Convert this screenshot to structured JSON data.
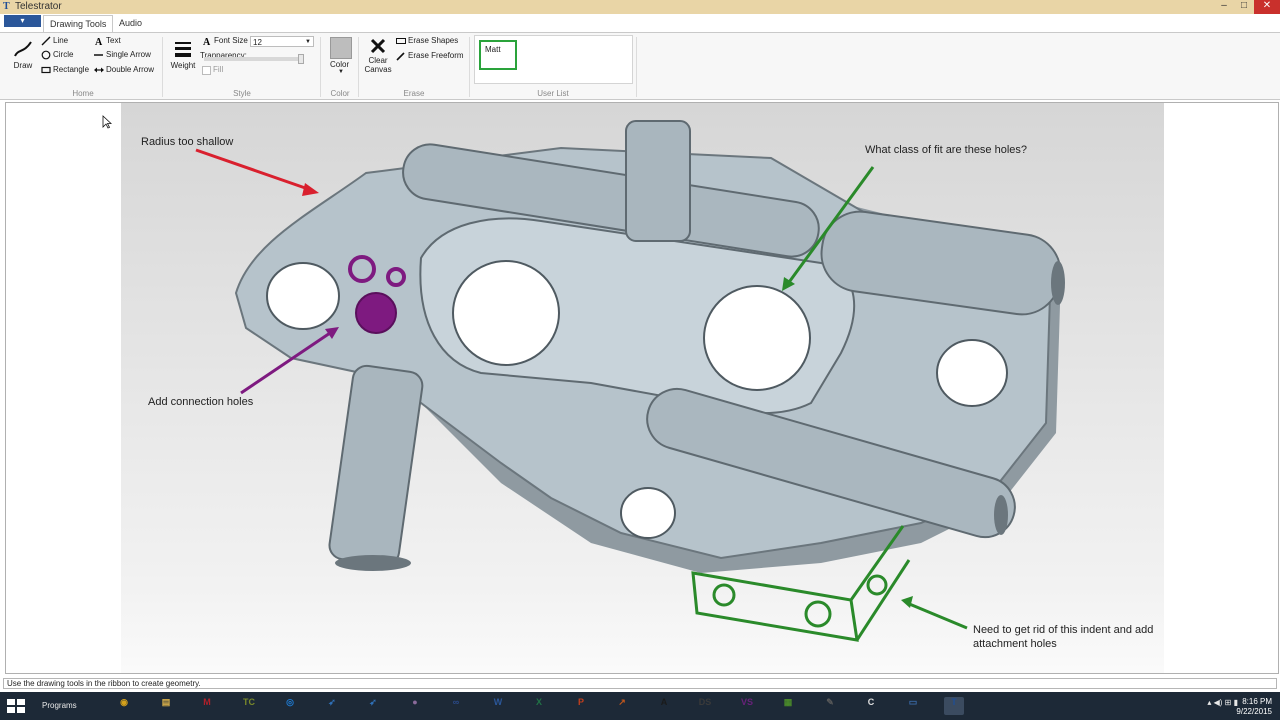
{
  "window": {
    "title": "Telestrator",
    "app_icon_letter": "T",
    "minimize": "–",
    "maximize": "□",
    "close": "✕"
  },
  "tabs": {
    "file_arrow": "▾",
    "drawing_tools": "Drawing Tools",
    "audio": "Audio"
  },
  "ribbon": {
    "home": {
      "draw": "Draw",
      "line": "Line",
      "circle": "Circle",
      "rectangle": "Rectangle",
      "text": "Text",
      "single_arrow": "Single Arrow",
      "double_arrow": "Double Arrow",
      "group_label": "Home"
    },
    "style": {
      "weight": "Weight",
      "font_size_label": "Font Size",
      "font_size_value": "12",
      "transparency": "Tranparency:",
      "fill": "Fill",
      "group_label": "Style"
    },
    "color": {
      "color": "Color",
      "group_label": "Color"
    },
    "erase": {
      "clear_canvas_line1": "Clear",
      "clear_canvas_line2": "Canvas",
      "erase_shapes": "Erase Shapes",
      "erase_freeform": "Erase Freeform",
      "group_label": "Erase"
    },
    "user_list": {
      "user": "Matt",
      "group_label": "User List"
    }
  },
  "annotations": {
    "radius": "Radius too shallow",
    "fit": "What class of fit are these holes?",
    "connection": "Add connection holes",
    "indent_line1": "Need to get rid of this indent and add",
    "indent_line2": "attachment holes"
  },
  "colors": {
    "red": "#d9202e",
    "green": "#2a8a2a",
    "purple": "#7e1a80"
  },
  "status": "Use the drawing tools in the ribbon to create geometry.",
  "taskbar": {
    "programs": "Programs",
    "apps": [
      {
        "name": "chrome",
        "glyph": "◉",
        "color": "#d6a21b"
      },
      {
        "name": "file-explorer",
        "glyph": "▤",
        "color": "#d9b04a"
      },
      {
        "name": "app-red",
        "glyph": "M",
        "color": "#b0202a"
      },
      {
        "name": "app-txc",
        "glyph": "TC",
        "color": "#7a8a2a"
      },
      {
        "name": "app-blue-circle",
        "glyph": "◎",
        "color": "#1e7ad1"
      },
      {
        "name": "app-swoosh",
        "glyph": "➶",
        "color": "#2f6fb6"
      },
      {
        "name": "app-swoosh-2",
        "glyph": "➶",
        "color": "#2f6fb6"
      },
      {
        "name": "app-sphere",
        "glyph": "●",
        "color": "#8a6a9a"
      },
      {
        "name": "app-link",
        "glyph": "∞",
        "color": "#2a4a8a"
      },
      {
        "name": "word",
        "glyph": "W",
        "color": "#2b579a"
      },
      {
        "name": "excel",
        "glyph": "X",
        "color": "#217346"
      },
      {
        "name": "powerpoint",
        "glyph": "P",
        "color": "#c43e1c"
      },
      {
        "name": "app-arrow",
        "glyph": "↗",
        "color": "#c2571c"
      },
      {
        "name": "app-a",
        "glyph": "A",
        "color": "#1a1a1a"
      },
      {
        "name": "app-ds",
        "glyph": "DS",
        "color": "#3a3a3a"
      },
      {
        "name": "visual-studio",
        "glyph": "VS",
        "color": "#68217a"
      },
      {
        "name": "app-notepad",
        "glyph": "▦",
        "color": "#4a8a2a"
      },
      {
        "name": "app-pen",
        "glyph": "✎",
        "color": "#5a5a5a"
      },
      {
        "name": "app-c",
        "glyph": "C",
        "color": "#e0e0e0"
      },
      {
        "name": "app-window",
        "glyph": "▭",
        "color": "#3a6aa8"
      },
      {
        "name": "telestrator",
        "glyph": "T",
        "color": "#1f4e96"
      }
    ],
    "tray": "▴   ◀)   ⊞   ▮",
    "time": "8:16 PM",
    "date": "9/22/2015"
  }
}
